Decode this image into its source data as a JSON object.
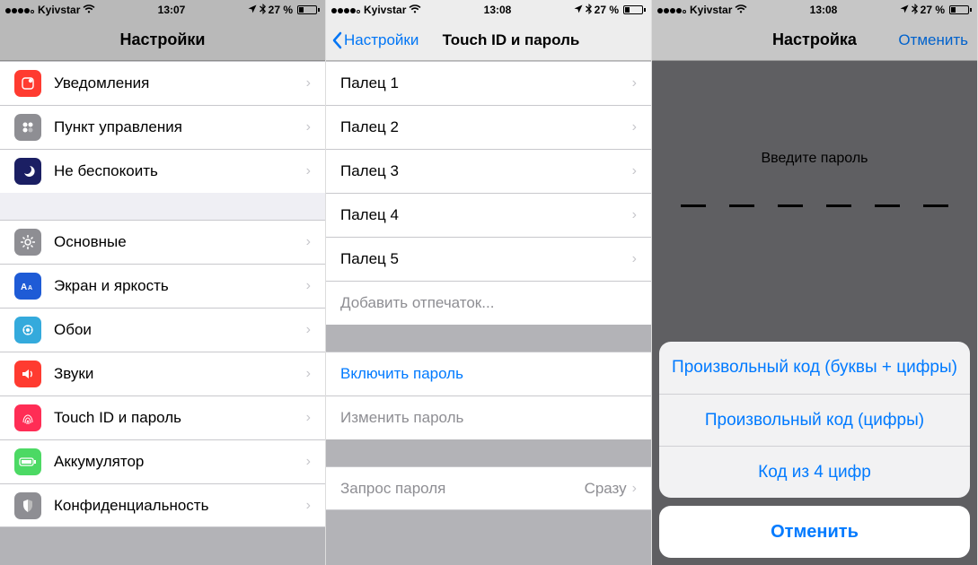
{
  "status": {
    "carrier": "Kyivstar",
    "time1": "13:07",
    "time2": "13:08",
    "time3": "13:08",
    "battery": "27 %"
  },
  "screen1": {
    "title": "Настройки",
    "rows_group1": [
      {
        "label": "Уведомления",
        "icon_bg": "#ff3b30"
      },
      {
        "label": "Пункт управления",
        "icon_bg": "#8e8e93"
      },
      {
        "label": "Не беспокоить",
        "icon_bg": "#1b1f63"
      }
    ],
    "rows_group2": [
      {
        "label": "Основные",
        "icon_bg": "#8e8e93"
      },
      {
        "label": "Экран и яркость",
        "icon_bg": "#1e5bd6"
      },
      {
        "label": "Обои",
        "icon_bg": "#34aadc"
      },
      {
        "label": "Звуки",
        "icon_bg": "#ff3b30"
      },
      {
        "label": "Touch ID и пароль",
        "icon_bg": "#ff2d55"
      },
      {
        "label": "Аккумулятор",
        "icon_bg": "#4cd964"
      },
      {
        "label": "Конфиденциальность",
        "icon_bg": "#8e8e93"
      }
    ]
  },
  "screen2": {
    "back": "Настройки",
    "title": "Touch ID и пароль",
    "fingers": [
      "Палец 1",
      "Палец 2",
      "Палец 3",
      "Палец 4",
      "Палец 5"
    ],
    "add_finger": "Добавить отпечаток...",
    "enable_passcode": "Включить пароль",
    "change_passcode": "Изменить пароль",
    "require_label": "Запрос пароля",
    "require_value": "Сразу"
  },
  "screen3": {
    "title": "Настройка",
    "cancel_nav": "Отменить",
    "prompt": "Введите пароль",
    "sheet_items": [
      "Произвольный код (буквы + цифры)",
      "Произвольный код (цифры)",
      "Код из 4 цифр"
    ],
    "sheet_cancel": "Отменить"
  }
}
